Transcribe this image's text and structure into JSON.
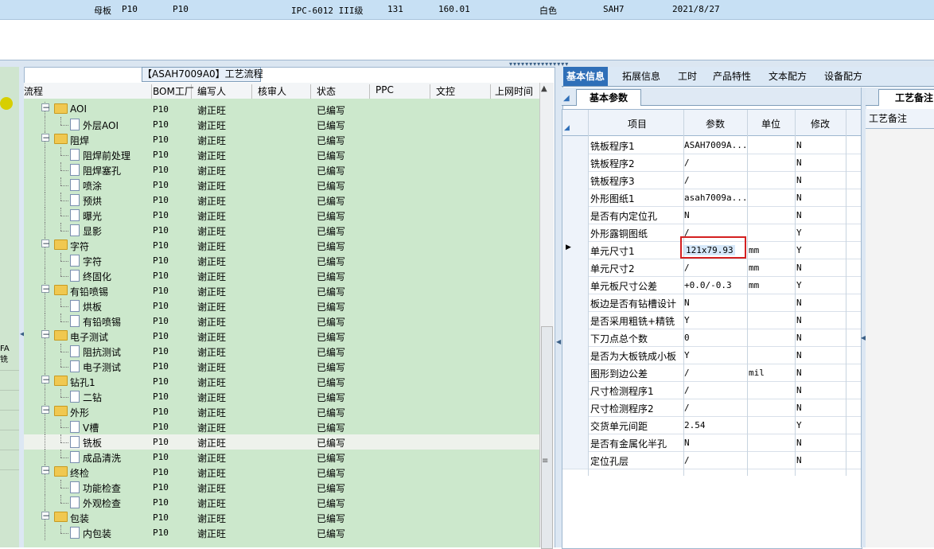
{
  "top_row": {
    "cells": [
      "母板",
      "P10",
      "P10",
      "IPC-6012 III级",
      "131",
      "160.01",
      "白色",
      "SAH7",
      "2021/8/27"
    ]
  },
  "left_panel": {
    "text": "FA 铣"
  },
  "flow_panel": {
    "title": "【ASAH7009A0】工艺流程",
    "columns": [
      "流程",
      "BOM工厂",
      "编写人",
      "核审人",
      "状态",
      "PPC",
      "文控",
      "上网时间"
    ],
    "rows": [
      {
        "name": "AOI",
        "level": 0,
        "type": "folder",
        "bom": "P10",
        "writer": "谢正旺",
        "status": "已编写"
      },
      {
        "name": "外层AOI",
        "level": 1,
        "type": "doc",
        "bom": "P10",
        "writer": "谢正旺",
        "status": "已编写"
      },
      {
        "name": "阻焊",
        "level": 0,
        "type": "folder",
        "bom": "P10",
        "writer": "谢正旺",
        "status": "已编写"
      },
      {
        "name": "阻焊前处理",
        "level": 1,
        "type": "doc",
        "bom": "P10",
        "writer": "谢正旺",
        "status": "已编写"
      },
      {
        "name": "阻焊塞孔",
        "level": 1,
        "type": "doc",
        "bom": "P10",
        "writer": "谢正旺",
        "status": "已编写"
      },
      {
        "name": "喷涂",
        "level": 1,
        "type": "doc",
        "bom": "P10",
        "writer": "谢正旺",
        "status": "已编写"
      },
      {
        "name": "预烘",
        "level": 1,
        "type": "doc",
        "bom": "P10",
        "writer": "谢正旺",
        "status": "已编写"
      },
      {
        "name": "曝光",
        "level": 1,
        "type": "doc",
        "bom": "P10",
        "writer": "谢正旺",
        "status": "已编写"
      },
      {
        "name": "显影",
        "level": 1,
        "type": "doc",
        "bom": "P10",
        "writer": "谢正旺",
        "status": "已编写"
      },
      {
        "name": "字符",
        "level": 0,
        "type": "folder",
        "bom": "P10",
        "writer": "谢正旺",
        "status": "已编写"
      },
      {
        "name": "字符",
        "level": 1,
        "type": "doc",
        "bom": "P10",
        "writer": "谢正旺",
        "status": "已编写"
      },
      {
        "name": "终固化",
        "level": 1,
        "type": "doc",
        "bom": "P10",
        "writer": "谢正旺",
        "status": "已编写"
      },
      {
        "name": "有铅喷锡",
        "level": 0,
        "type": "folder",
        "bom": "P10",
        "writer": "谢正旺",
        "status": "已编写"
      },
      {
        "name": "烘板",
        "level": 1,
        "type": "doc",
        "bom": "P10",
        "writer": "谢正旺",
        "status": "已编写"
      },
      {
        "name": "有铅喷锡",
        "level": 1,
        "type": "doc",
        "bom": "P10",
        "writer": "谢正旺",
        "status": "已编写"
      },
      {
        "name": "电子测试",
        "level": 0,
        "type": "folder",
        "bom": "P10",
        "writer": "谢正旺",
        "status": "已编写"
      },
      {
        "name": "阻抗测试",
        "level": 1,
        "type": "doc",
        "bom": "P10",
        "writer": "谢正旺",
        "status": "已编写"
      },
      {
        "name": "电子测试",
        "level": 1,
        "type": "doc",
        "bom": "P10",
        "writer": "谢正旺",
        "status": "已编写"
      },
      {
        "name": "钻孔1",
        "level": 0,
        "type": "folder",
        "bom": "P10",
        "writer": "谢正旺",
        "status": "已编写"
      },
      {
        "name": "二钻",
        "level": 1,
        "type": "doc",
        "bom": "P10",
        "writer": "谢正旺",
        "status": "已编写"
      },
      {
        "name": "外形",
        "level": 0,
        "type": "folder",
        "bom": "P10",
        "writer": "谢正旺",
        "status": "已编写"
      },
      {
        "name": "V槽",
        "level": 1,
        "type": "doc",
        "bom": "P10",
        "writer": "谢正旺",
        "status": "已编写"
      },
      {
        "name": "铣板",
        "level": 1,
        "type": "doc",
        "bom": "P10",
        "writer": "谢正旺",
        "status": "已编写",
        "selected": true
      },
      {
        "name": "成品清洗",
        "level": 1,
        "type": "doc",
        "bom": "P10",
        "writer": "谢正旺",
        "status": "已编写"
      },
      {
        "name": "终检",
        "level": 0,
        "type": "folder",
        "bom": "P10",
        "writer": "谢正旺",
        "status": "已编写"
      },
      {
        "name": "功能检查",
        "level": 1,
        "type": "doc",
        "bom": "P10",
        "writer": "谢正旺",
        "status": "已编写"
      },
      {
        "name": "外观检查",
        "level": 1,
        "type": "doc",
        "bom": "P10",
        "writer": "谢正旺",
        "status": "已编写"
      },
      {
        "name": "包装",
        "level": 0,
        "type": "folder",
        "bom": "P10",
        "writer": "谢正旺",
        "status": "已编写"
      },
      {
        "name": "内包装",
        "level": 1,
        "type": "doc",
        "bom": "P10",
        "writer": "谢正旺",
        "status": "已编写"
      }
    ]
  },
  "tabs": [
    "基本信息",
    "拓展信息",
    "工时",
    "产品特性",
    "文本配方",
    "设备配方"
  ],
  "active_tab": 0,
  "subtab": "基本参数",
  "param_grid": {
    "columns": [
      "项目",
      "参数",
      "单位",
      "修改"
    ],
    "rows": [
      {
        "item": "铣板程序1",
        "param": "ASAH7009A...",
        "unit": "",
        "mod": "N"
      },
      {
        "item": "铣板程序2",
        "param": "/",
        "unit": "",
        "mod": "N"
      },
      {
        "item": "铣板程序3",
        "param": "/",
        "unit": "",
        "mod": "N"
      },
      {
        "item": "外形图纸1",
        "param": "asah7009a...",
        "unit": "",
        "mod": "N"
      },
      {
        "item": "是否有内定位孔",
        "param": "N",
        "unit": "",
        "mod": "N"
      },
      {
        "item": "外形露铜图纸",
        "param": "/",
        "unit": "",
        "mod": "Y"
      },
      {
        "item": "单元尺寸1",
        "param": "121x79.93",
        "unit": "mm",
        "mod": "Y",
        "current": true
      },
      {
        "item": "单元尺寸2",
        "param": "/",
        "unit": "mm",
        "mod": "N"
      },
      {
        "item": "单元板尺寸公差",
        "param": "+0.0/-0.3",
        "unit": "mm",
        "mod": "Y"
      },
      {
        "item": "板边是否有钻槽设计",
        "param": "N",
        "unit": "",
        "mod": "N"
      },
      {
        "item": "是否采用粗铣+精铣",
        "param": "Y",
        "unit": "",
        "mod": "N"
      },
      {
        "item": "下刀点总个数",
        "param": "0",
        "unit": "",
        "mod": "N"
      },
      {
        "item": "是否为大板铣成小板",
        "param": "Y",
        "unit": "",
        "mod": "N"
      },
      {
        "item": "图形到边公差",
        "param": "/",
        "unit": "mil",
        "mod": "N"
      },
      {
        "item": "尺寸检测程序1",
        "param": "/",
        "unit": "",
        "mod": "N"
      },
      {
        "item": "尺寸检测程序2",
        "param": "/",
        "unit": "",
        "mod": "N"
      },
      {
        "item": "交货单元间距",
        "param": "2.54",
        "unit": "",
        "mod": "Y"
      },
      {
        "item": "是否有金属化半孔",
        "param": "N",
        "unit": "",
        "mod": "N"
      },
      {
        "item": "定位孔层",
        "param": "/",
        "unit": "",
        "mod": "N"
      }
    ]
  },
  "remark": {
    "tab": "工艺备注",
    "header": "工艺备注"
  },
  "colors": {
    "tree_bg": "#cce8cc",
    "tab_active": "#2f6fb8",
    "highlight": "#d42020",
    "top_row": "#c7e0f4"
  },
  "icons": [
    "folder-icon",
    "document-icon",
    "expand-toggle-icon",
    "scroll-up-icon",
    "current-row-arrow-icon"
  ]
}
